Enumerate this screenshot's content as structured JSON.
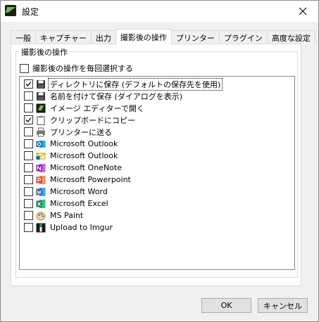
{
  "window": {
    "title": "設定"
  },
  "tabs": [
    {
      "label": "一般"
    },
    {
      "label": "キャプチャー"
    },
    {
      "label": "出力"
    },
    {
      "label": "撮影後の操作",
      "active": true
    },
    {
      "label": "プリンター"
    },
    {
      "label": "プラグイン"
    },
    {
      "label": "高度な設定"
    }
  ],
  "group": {
    "title": "撮影後の操作",
    "ask_each_time": {
      "label": "撮影後の操作を毎回選択する",
      "checked": false
    }
  },
  "destinations": [
    {
      "label": "ディレクトリに保存 (デフォルトの保存先を使用)",
      "checked": true,
      "icon": "floppy-icon"
    },
    {
      "label": "名前を付けて保存 (ダイアログを表示)",
      "checked": false,
      "icon": "floppy-icon"
    },
    {
      "label": "イメージ エディターで開く",
      "checked": false,
      "icon": "greenshot-editor-icon"
    },
    {
      "label": "クリップボードにコピー",
      "checked": true,
      "icon": "clipboard-icon"
    },
    {
      "label": "プリンターに送る",
      "checked": false,
      "icon": "printer-icon"
    },
    {
      "label": "Microsoft Outlook",
      "checked": false,
      "icon": "outlook-icon"
    },
    {
      "label": "Microsoft Outlook",
      "checked": false,
      "icon": "outlook-mail-icon"
    },
    {
      "label": "Microsoft OneNote",
      "checked": false,
      "icon": "onenote-icon"
    },
    {
      "label": "Microsoft Powerpoint",
      "checked": false,
      "icon": "powerpoint-icon"
    },
    {
      "label": "Microsoft Word",
      "checked": false,
      "icon": "word-icon"
    },
    {
      "label": "Microsoft Excel",
      "checked": false,
      "icon": "excel-icon"
    },
    {
      "label": "MS Paint",
      "checked": false,
      "icon": "paint-icon"
    },
    {
      "label": "Upload to Imgur",
      "checked": false,
      "icon": "imgur-icon"
    }
  ],
  "buttons": {
    "ok": "OK",
    "cancel": "キャンセル"
  },
  "colors": {
    "outlook": "#0a64ad",
    "onenote": "#7719aa",
    "powerpoint": "#d24726",
    "word": "#2b579a",
    "excel": "#217346",
    "imgur": "#1bb76e"
  }
}
